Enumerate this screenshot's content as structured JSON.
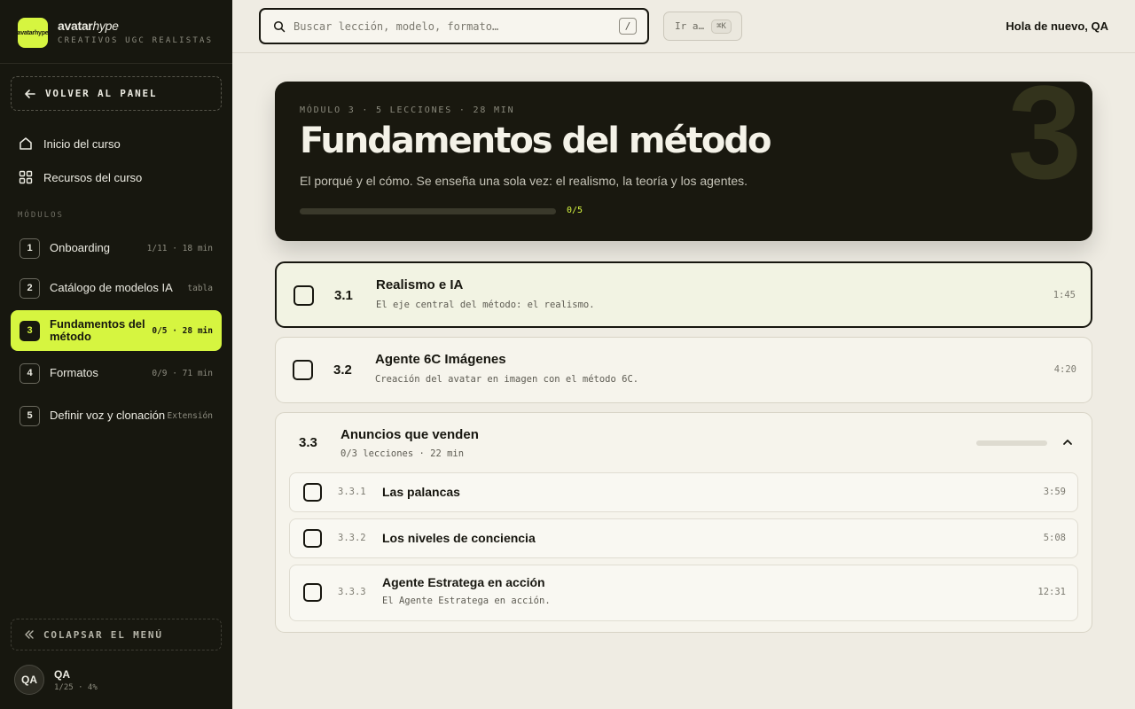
{
  "brand": {
    "logo_text": "avatarhype",
    "name_main": "avatar",
    "name_accent": "hype",
    "subtitle": "CREATIVOS UGC REALISTAS"
  },
  "sidebar": {
    "back_label": "VOLVER AL PANEL",
    "nav": [
      {
        "label": "Inicio del curso",
        "icon": "home-icon"
      },
      {
        "label": "Recursos del curso",
        "icon": "grid-icon"
      }
    ],
    "modules_label": "MÓDULOS",
    "modules": [
      {
        "num": "1",
        "title": "Onboarding",
        "meta": "1/11 · 18 min",
        "active": false
      },
      {
        "num": "2",
        "title": "Catálogo de modelos IA",
        "meta": "tabla",
        "active": false
      },
      {
        "num": "3",
        "title": "Fundamentos del método",
        "meta": "0/5 · 28 min",
        "active": true
      },
      {
        "num": "4",
        "title": "Formatos",
        "meta": "0/9 · 71 min",
        "active": false
      },
      {
        "num": "5",
        "title": "Definir voz y clonación",
        "meta": "Extensión",
        "active": false
      }
    ],
    "collapse_label": "COLAPSAR EL MENÚ",
    "user": {
      "initials": "QA",
      "name": "QA",
      "stats": "1/25 · 4%"
    }
  },
  "topbar": {
    "search_placeholder": "Buscar lección, modelo, formato…",
    "search_shortcut": "/",
    "goto_label": "Ir a…",
    "goto_shortcut": "⌘K",
    "greeting": "Hola de nuevo, QA"
  },
  "hero": {
    "big_number": "3",
    "meta": "MÓDULO 3 · 5 LECCIONES · 28 MIN",
    "title": "Fundamentos del método",
    "description": "El porqué y el cómo. Se enseña una sola vez: el realismo, la teoría y los agentes.",
    "progress_fraction": 0,
    "progress_label": "0/5"
  },
  "lessons": [
    {
      "num": "3.1",
      "title": "Realismo e IA",
      "desc": "El eje central del método: el realismo.",
      "duration": "1:45",
      "current": true
    },
    {
      "num": "3.2",
      "title": "Agente 6C Imágenes",
      "desc": "Creación del avatar en imagen con el método 6C.",
      "duration": "4:20",
      "current": false
    }
  ],
  "group": {
    "num": "3.3",
    "title": "Anuncios que venden",
    "meta": "0/3 lecciones · 22 min",
    "progress_fraction": 0,
    "expanded": true,
    "items": [
      {
        "num": "3.3.1",
        "title": "Las palancas",
        "desc": "",
        "duration": "3:59"
      },
      {
        "num": "3.3.2",
        "title": "Los niveles de conciencia",
        "desc": "",
        "duration": "5:08"
      },
      {
        "num": "3.3.3",
        "title": "Agente Estratega en acción",
        "desc": "El Agente Estratega en acción.",
        "duration": "12:31"
      }
    ]
  },
  "colors": {
    "accent": "#d6f540",
    "sidebar_bg": "#17170f",
    "page_bg": "#efece3",
    "hero_bg": "#19180f"
  }
}
